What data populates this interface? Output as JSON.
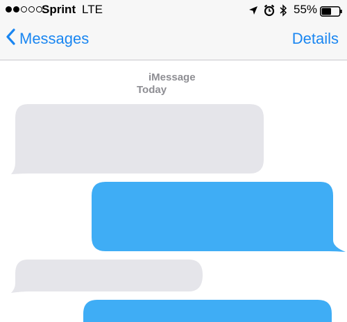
{
  "status_bar": {
    "carrier": "Sprint",
    "network": "LTE",
    "signal_bars_filled": 2,
    "signal_bars_total": 5,
    "battery_percent": "55%",
    "battery_level": 0.55,
    "icons": [
      "location-arrow-icon",
      "alarm-clock-icon",
      "bluetooth-icon",
      "battery-icon"
    ]
  },
  "nav": {
    "back_label": "Messages",
    "details_label": "Details",
    "back_icon": "chevron-left-icon"
  },
  "conversation": {
    "service": "iMessage",
    "date": "Today",
    "messages": [
      {
        "direction": "incoming",
        "color": "#e5e5ea"
      },
      {
        "direction": "outgoing",
        "color": "#3fadf5"
      },
      {
        "direction": "incoming",
        "color": "#e5e5ea"
      },
      {
        "direction": "outgoing",
        "color": "#3fadf5"
      }
    ]
  },
  "colors": {
    "accent": "#1a86f1",
    "incoming_bubble": "#e5e5ea",
    "outgoing_bubble": "#3fadf5",
    "meta_text": "#8e8e93"
  }
}
